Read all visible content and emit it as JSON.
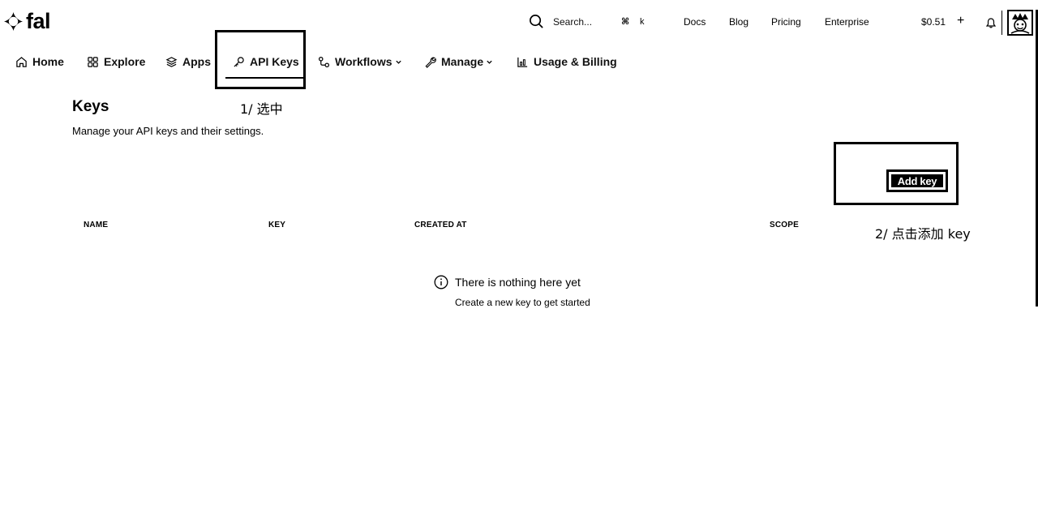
{
  "brand": {
    "name": "fal"
  },
  "search": {
    "placeholder": "Search...",
    "shortcut_symbol": "⌘",
    "shortcut_key": "k"
  },
  "top_links": [
    "Docs",
    "Blog",
    "Pricing",
    "Enterprise"
  ],
  "account": {
    "credit": "$0.51",
    "add_symbol": "+"
  },
  "nav": {
    "items": [
      {
        "label": "Home",
        "icon": "home-icon"
      },
      {
        "label": "Explore",
        "icon": "grid-icon"
      },
      {
        "label": "Apps",
        "icon": "layers-icon"
      },
      {
        "label": "API Keys",
        "icon": "key-icon",
        "active": true
      },
      {
        "label": "Workflows",
        "icon": "workflow-icon",
        "dropdown": true
      },
      {
        "label": "Manage",
        "icon": "wrench-icon",
        "dropdown": true
      },
      {
        "label": "Usage & Billing",
        "icon": "chart-icon"
      }
    ]
  },
  "page": {
    "title": "Keys",
    "subtitle": "Manage your API keys and their settings.",
    "add_button": "Add key"
  },
  "table": {
    "columns": [
      "NAME",
      "KEY",
      "CREATED AT",
      "SCOPE"
    ]
  },
  "empty_state": {
    "icon": "info-icon",
    "title": "There is nothing here yet",
    "subtitle": "Create a new key to get started"
  },
  "annotations": {
    "step1": "1/ 选中",
    "step2": "2/ 点击添加 key"
  }
}
